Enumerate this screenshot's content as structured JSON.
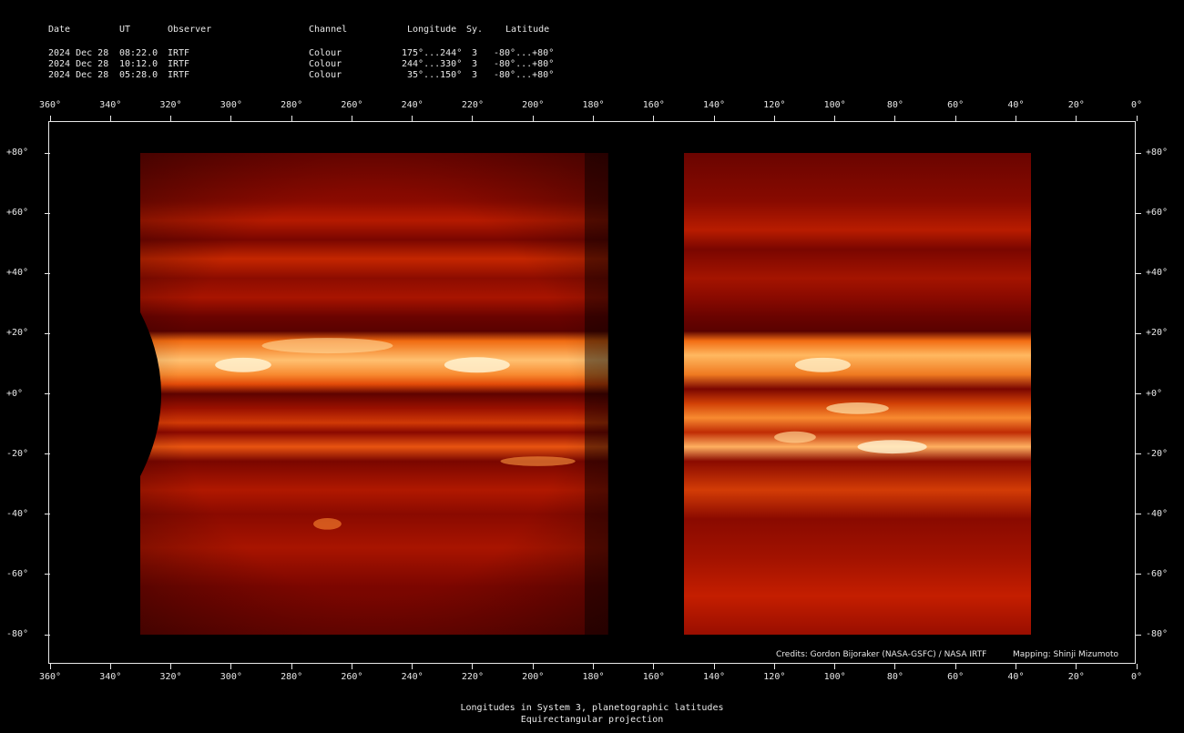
{
  "header": {
    "columns": {
      "date": "Date",
      "ut": "UT",
      "observer": "Observer",
      "channel": "Channel",
      "longitude": "Longitude",
      "system": "Sy.",
      "latitude": "Latitude"
    },
    "rows": [
      {
        "date": "2024 Dec 28",
        "ut": "08:22.0",
        "observer": "IRTF",
        "channel": "Colour",
        "longitude": "175°...244°",
        "system": "3",
        "latitude": "-80°...+80°"
      },
      {
        "date": "2024 Dec 28",
        "ut": "10:12.0",
        "observer": "IRTF",
        "channel": "Colour",
        "longitude": "244°...330°",
        "system": "3",
        "latitude": "-80°...+80°"
      },
      {
        "date": "2024 Dec 28",
        "ut": "05:28.0",
        "observer": "IRTF",
        "channel": "Colour",
        "longitude": "35°...150°",
        "system": "3",
        "latitude": "-80°...+80°"
      }
    ]
  },
  "axes": {
    "longitude_ticks": [
      "360°",
      "340°",
      "320°",
      "300°",
      "280°",
      "260°",
      "240°",
      "220°",
      "200°",
      "180°",
      "160°",
      "140°",
      "120°",
      "100°",
      "80°",
      "60°",
      "40°",
      "20°",
      "0°"
    ],
    "latitude_ticks": [
      "+80°",
      "+60°",
      "+40°",
      "+20°",
      "+0°",
      "-20°",
      "-40°",
      "-60°",
      "-80°"
    ]
  },
  "panels": [
    {
      "lon_from": 330,
      "lon_to": 175
    },
    {
      "lon_from": 150,
      "lon_to": 35
    }
  ],
  "credits": "Credits: Gordon Bijoraker (NASA-GSFC) / NASA IRTF",
  "mapping": "Mapping: Shinji Mizumoto",
  "footer": {
    "line1": "Longitudes in System 3, planetographic latitudes",
    "line2": "Equirectangular projection"
  }
}
